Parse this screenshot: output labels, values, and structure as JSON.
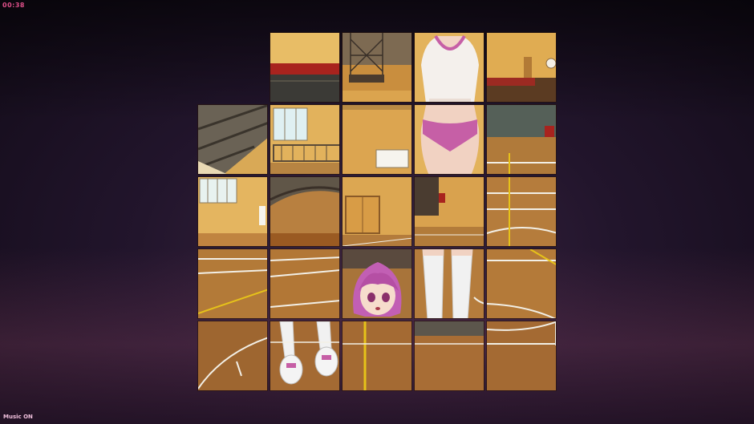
{
  "hud": {
    "timer": "00:38",
    "music_status": "Music ON"
  },
  "colors": {
    "timer": "#e0508a",
    "floor": "#c88a38",
    "floor_dark": "#9a5a22",
    "wall": "#e3b35c",
    "line_white": "#f2efe6",
    "line_yellow": "#e6c21a",
    "hair": "#c25fb4",
    "shirt": "#f4f0ec",
    "shorts": "#c65fa6"
  },
  "puzzle": {
    "grid_size": 5,
    "empty_slot": "row1-col1",
    "tiles": [
      {
        "id": "r1c2",
        "scene": "wall-red-trim"
      },
      {
        "id": "r1c3",
        "scene": "basketball-hoop"
      },
      {
        "id": "r1c4",
        "scene": "girl-torso"
      },
      {
        "id": "r1c5",
        "scene": "wall-clock"
      },
      {
        "id": "r2c1",
        "scene": "ceiling-beam"
      },
      {
        "id": "r2c2",
        "scene": "windows-balcony"
      },
      {
        "id": "r2c3",
        "scene": "scoreboard"
      },
      {
        "id": "r2c4",
        "scene": "girl-hips"
      },
      {
        "id": "r2c5",
        "scene": "court-corner"
      },
      {
        "id": "r3c1",
        "scene": "windows-wall"
      },
      {
        "id": "r3c2",
        "scene": "ceiling-arch"
      },
      {
        "id": "r3c3",
        "scene": "double-door"
      },
      {
        "id": "r3c4",
        "scene": "court-wall"
      },
      {
        "id": "r3c5",
        "scene": "court-lines"
      },
      {
        "id": "r4c1",
        "scene": "floor-lines"
      },
      {
        "id": "r4c2",
        "scene": "floor-lines-2"
      },
      {
        "id": "r4c3",
        "scene": "girl-face"
      },
      {
        "id": "r4c4",
        "scene": "girl-legs"
      },
      {
        "id": "r4c5",
        "scene": "floor-arc"
      },
      {
        "id": "r5c1",
        "scene": "floor-arc-2"
      },
      {
        "id": "r5c2",
        "scene": "girl-shoes"
      },
      {
        "id": "r5c3",
        "scene": "floor-center-line"
      },
      {
        "id": "r5c4",
        "scene": "floor-wall-edge"
      },
      {
        "id": "r5c5",
        "scene": "floor-key"
      }
    ]
  }
}
